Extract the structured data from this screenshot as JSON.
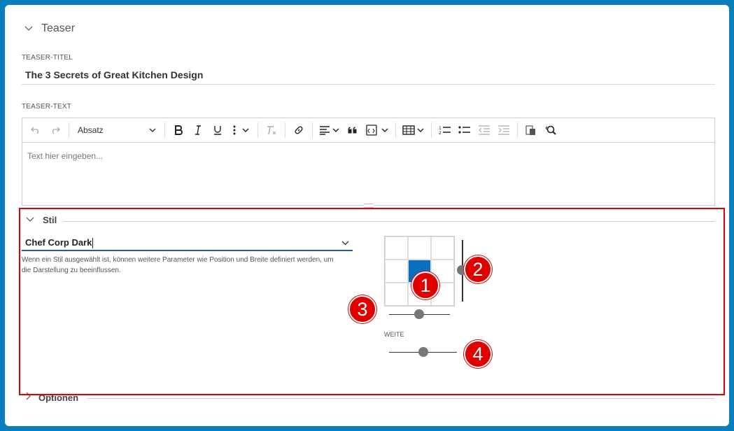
{
  "teaser": {
    "section_title": "Teaser"
  },
  "fields": {
    "title_label": "TEASER-TITEL",
    "title_value": "The 3 Secrets of Great Kitchen Design",
    "text_label": "TEASER-TEXT",
    "text_placeholder": "Text hier eingeben..."
  },
  "toolbar": {
    "paragraph_select": "Absatz",
    "icons": [
      "undo-icon",
      "redo-icon",
      "bold-icon",
      "italic-icon",
      "underline-icon",
      "more-icon",
      "remove-format-icon",
      "link-icon",
      "align-icon",
      "blockquote-icon",
      "source-icon",
      "table-icon",
      "numbered-list-icon",
      "bulleted-list-icon",
      "outdent-icon",
      "indent-icon",
      "paste-icon",
      "find-replace-icon"
    ]
  },
  "stil": {
    "section_title": "Stil",
    "selected_style": "Chef Corp Dark",
    "help_line1": "Wenn ein Stil ausgewählt ist, können weitere Parameter wie Position und Breite definiert werden, um",
    "help_line2": "die Darstellung zu beeinflussen.",
    "position_grid": {
      "rows": 3,
      "cols": 3,
      "active_row": 1,
      "active_col": 1
    },
    "weite_label": "WEITE",
    "vertical_slider_value": 0.5,
    "horizontal_slider_value": 0.5,
    "weite_slider_value": 0.5
  },
  "badges": [
    "1",
    "2",
    "3",
    "4"
  ],
  "optionen": {
    "section_title": "Optionen"
  },
  "colors": {
    "frame": "#0a7fc0",
    "highlight": "#e00000",
    "accent": "#1f5fa8",
    "active_cell": "#0a6fbf"
  }
}
